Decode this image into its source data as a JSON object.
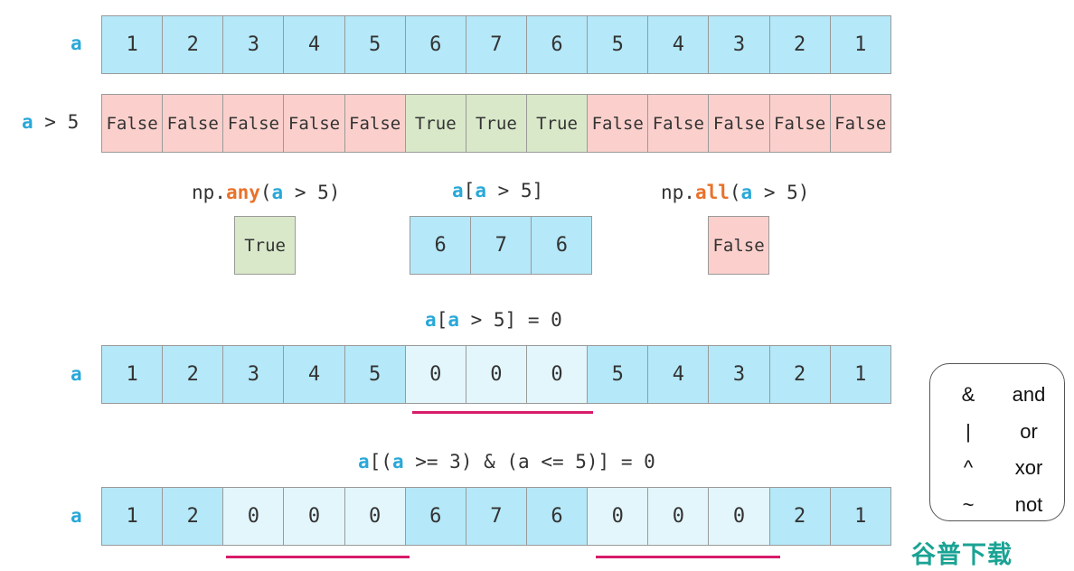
{
  "colors": {
    "array": "#b5e8f8",
    "zeroed": "#e3f6fc",
    "false": "#fbd0cc",
    "true": "#d9e8c9",
    "highlight": "#29a8d8",
    "function": "#e8722a",
    "underline": "#d81b6a"
  },
  "row_a": {
    "label": "a",
    "values": [
      "1",
      "2",
      "3",
      "4",
      "5",
      "6",
      "7",
      "6",
      "5",
      "4",
      "3",
      "2",
      "1"
    ]
  },
  "row_mask": {
    "label_var": "a",
    "label_rest": " > 5",
    "values": [
      "False",
      "False",
      "False",
      "False",
      "False",
      "True",
      "True",
      "True",
      "False",
      "False",
      "False",
      "False",
      "False"
    ]
  },
  "any": {
    "prefix": "np.",
    "fn": "any",
    "open": "(",
    "var": "a",
    "rest": " > 5)",
    "result": "True"
  },
  "index": {
    "var1": "a",
    "mid": "[",
    "var2": "a",
    "rest": " > 5]",
    "values": [
      "6",
      "7",
      "6"
    ]
  },
  "all": {
    "prefix": "np.",
    "fn": "all",
    "open": "(",
    "var": "a",
    "rest": " > 5)",
    "result": "False"
  },
  "assign1": {
    "var1": "a",
    "mid": "[",
    "var2": "a",
    "rest": " > 5] = 0",
    "label": "a",
    "values": [
      "1",
      "2",
      "3",
      "4",
      "5",
      "0",
      "0",
      "0",
      "5",
      "4",
      "3",
      "2",
      "1"
    ],
    "zeroed": [
      5,
      6,
      7
    ]
  },
  "assign2": {
    "var1": "a",
    "mid": "[(",
    "var2": "a",
    "rest": " >= 3) & (a <= 5)] = 0",
    "label": "a",
    "values": [
      "1",
      "2",
      "0",
      "0",
      "0",
      "6",
      "7",
      "6",
      "0",
      "0",
      "0",
      "2",
      "1"
    ],
    "zeroed": [
      2,
      3,
      4,
      8,
      9,
      10
    ]
  },
  "legend": [
    {
      "symbol": "&",
      "word": "and"
    },
    {
      "symbol": "|",
      "word": "or"
    },
    {
      "symbol": "^",
      "word": "xor"
    },
    {
      "symbol": "~",
      "word": "not"
    }
  ],
  "watermark": "谷普下载"
}
